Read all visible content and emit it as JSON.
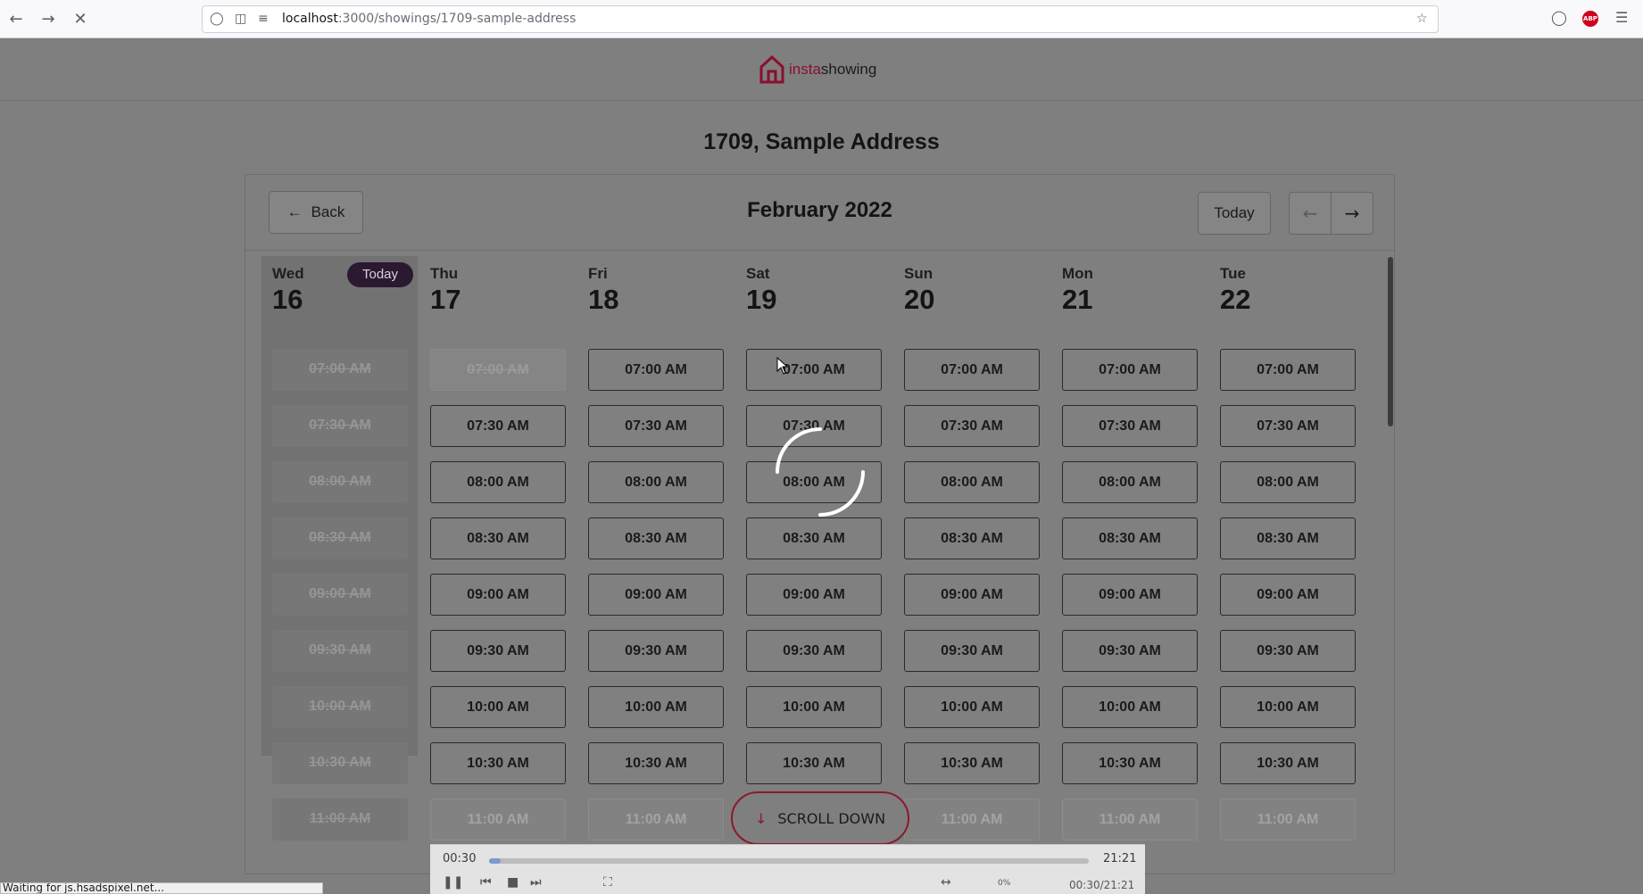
{
  "browser": {
    "url_host": "localhost",
    "url_path": ":3000/showings/1709-sample-address",
    "status_text": "Waiting for js.hsadspixel.net..."
  },
  "header": {
    "logo_prefix": "insta",
    "logo_suffix": "showing"
  },
  "page": {
    "address_title": "1709, Sample Address"
  },
  "calendar": {
    "back_label": "Back",
    "month_title": "February 2022",
    "today_button_label": "Today",
    "today_pill": "Today",
    "days": [
      {
        "name": "Wed",
        "num": "16",
        "is_today": true
      },
      {
        "name": "Thu",
        "num": "17",
        "is_today": false
      },
      {
        "name": "Fri",
        "num": "18",
        "is_today": false
      },
      {
        "name": "Sat",
        "num": "19",
        "is_today": false
      },
      {
        "name": "Sun",
        "num": "20",
        "is_today": false
      },
      {
        "name": "Mon",
        "num": "21",
        "is_today": false
      },
      {
        "name": "Tue",
        "num": "22",
        "is_today": false
      }
    ],
    "times": [
      "07:00 AM",
      "07:30 AM",
      "08:00 AM",
      "08:30 AM",
      "09:00 AM",
      "09:30 AM",
      "10:00 AM",
      "10:30 AM",
      "11:00 AM"
    ]
  },
  "scroll_down_label": "SCROLL DOWN",
  "media": {
    "elapsed": "00:30",
    "duration": "21:21",
    "combined": "00:30/21:21",
    "volume_label": "0%",
    "progress": 0.02
  },
  "colors": {
    "brand": "#8a0f2e",
    "today_pill": "#2a1930"
  }
}
